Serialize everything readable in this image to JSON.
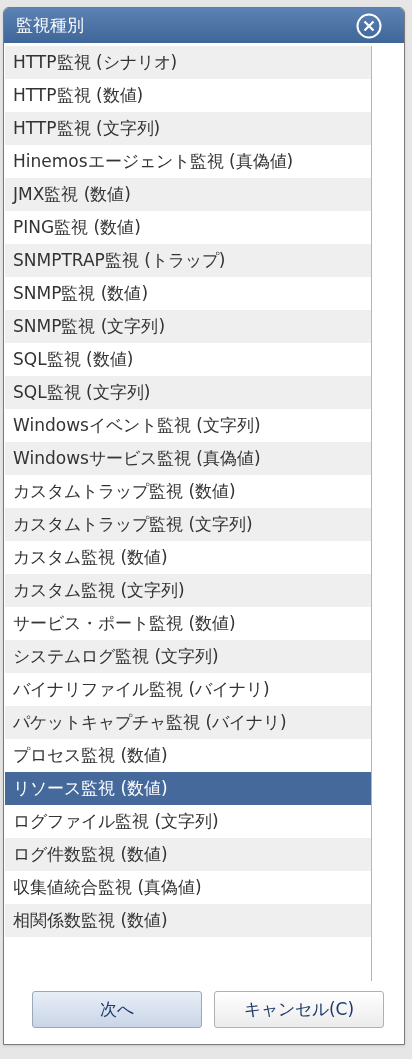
{
  "dialog": {
    "title": "監視種別"
  },
  "items": [
    {
      "label": "HTTP監視 (シナリオ)",
      "selected": false
    },
    {
      "label": "HTTP監視 (数値)",
      "selected": false
    },
    {
      "label": "HTTP監視 (文字列)",
      "selected": false
    },
    {
      "label": "Hinemosエージェント監視 (真偽値)",
      "selected": false
    },
    {
      "label": "JMX監視 (数値)",
      "selected": false
    },
    {
      "label": "PING監視 (数値)",
      "selected": false
    },
    {
      "label": "SNMPTRAP監視 (トラップ)",
      "selected": false
    },
    {
      "label": "SNMP監視 (数値)",
      "selected": false
    },
    {
      "label": "SNMP監視 (文字列)",
      "selected": false
    },
    {
      "label": "SQL監視 (数値)",
      "selected": false
    },
    {
      "label": "SQL監視 (文字列)",
      "selected": false
    },
    {
      "label": "Windowsイベント監視 (文字列)",
      "selected": false
    },
    {
      "label": "Windowsサービス監視 (真偽値)",
      "selected": false
    },
    {
      "label": "カスタムトラップ監視 (数値)",
      "selected": false
    },
    {
      "label": "カスタムトラップ監視 (文字列)",
      "selected": false
    },
    {
      "label": "カスタム監視 (数値)",
      "selected": false
    },
    {
      "label": "カスタム監視 (文字列)",
      "selected": false
    },
    {
      "label": "サービス・ポート監視 (数値)",
      "selected": false
    },
    {
      "label": "システムログ監視 (文字列)",
      "selected": false
    },
    {
      "label": "バイナリファイル監視 (バイナリ)",
      "selected": false
    },
    {
      "label": "パケットキャプチャ監視 (バイナリ)",
      "selected": false
    },
    {
      "label": "プロセス監視 (数値)",
      "selected": false
    },
    {
      "label": "リソース監視 (数値)",
      "selected": true
    },
    {
      "label": "ログファイル監視 (文字列)",
      "selected": false
    },
    {
      "label": "ログ件数監視 (数値)",
      "selected": false
    },
    {
      "label": "収集値統合監視 (真偽値)",
      "selected": false
    },
    {
      "label": "相関係数監視 (数値)",
      "selected": false
    }
  ],
  "buttons": [
    {
      "label": "次へ",
      "kind": "primary"
    },
    {
      "label": "キャンセル(C)",
      "kind": "secondary"
    }
  ]
}
